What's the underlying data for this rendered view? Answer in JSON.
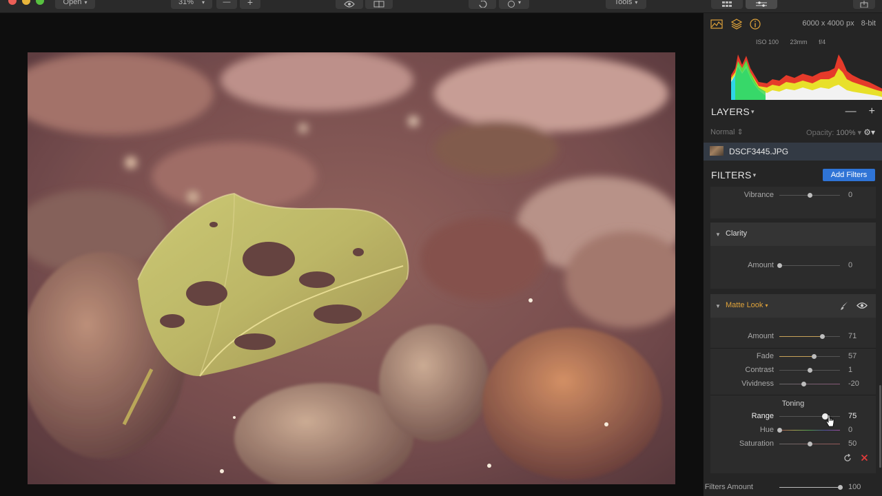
{
  "toolbar": {
    "open_label": "Open",
    "zoom_value": "31%",
    "zoom_out_label": "—",
    "zoom_in_label": "+",
    "tools_label": "Tools"
  },
  "info": {
    "dimensions": "6000 x 4000 px",
    "bit_depth": "8-bit",
    "iso": "ISO 100",
    "focal_length": "23mm",
    "aperture": "f/4"
  },
  "layers": {
    "title": "LAYERS",
    "blend_mode": "Normal",
    "opacity_label": "Opacity:",
    "opacity_value": "100%",
    "layer_name": "DSCF3445.JPG",
    "remove_label": "—",
    "add_label": "+"
  },
  "filters": {
    "title": "FILTERS",
    "add_button": "Add Filters",
    "vibrance": {
      "label": "Vibrance",
      "value": "0",
      "level": 0.5
    },
    "clarity": {
      "name": "Clarity",
      "amount": {
        "label": "Amount",
        "value": "0",
        "level": 0.0
      }
    },
    "matte": {
      "name": "Matte Look",
      "amount": {
        "label": "Amount",
        "value": "71",
        "level": 0.71
      },
      "fade": {
        "label": "Fade",
        "value": "57",
        "level": 0.57
      },
      "contrast": {
        "label": "Contrast",
        "value": "1",
        "level": 0.5
      },
      "vividness": {
        "label": "Vividness",
        "value": "-20",
        "level": 0.4
      },
      "toning_title": "Toning",
      "range": {
        "label": "Range",
        "value": "75",
        "level": 0.75
      },
      "hue": {
        "label": "Hue",
        "value": "0",
        "level": 0.0
      },
      "saturation": {
        "label": "Saturation",
        "value": "50",
        "level": 0.5
      }
    },
    "filters_amount": {
      "label": "Filters Amount",
      "value": "100",
      "level": 1.0
    }
  },
  "colors": {
    "accent_blue": "#2f74d6",
    "matte_orange": "#e0a33a",
    "remove_red": "#e03b3b"
  },
  "icons": [
    "histogram-icon",
    "layers-icon",
    "info-icon",
    "brush-icon",
    "eye-icon",
    "reset-icon",
    "close-icon",
    "gear-icon"
  ]
}
